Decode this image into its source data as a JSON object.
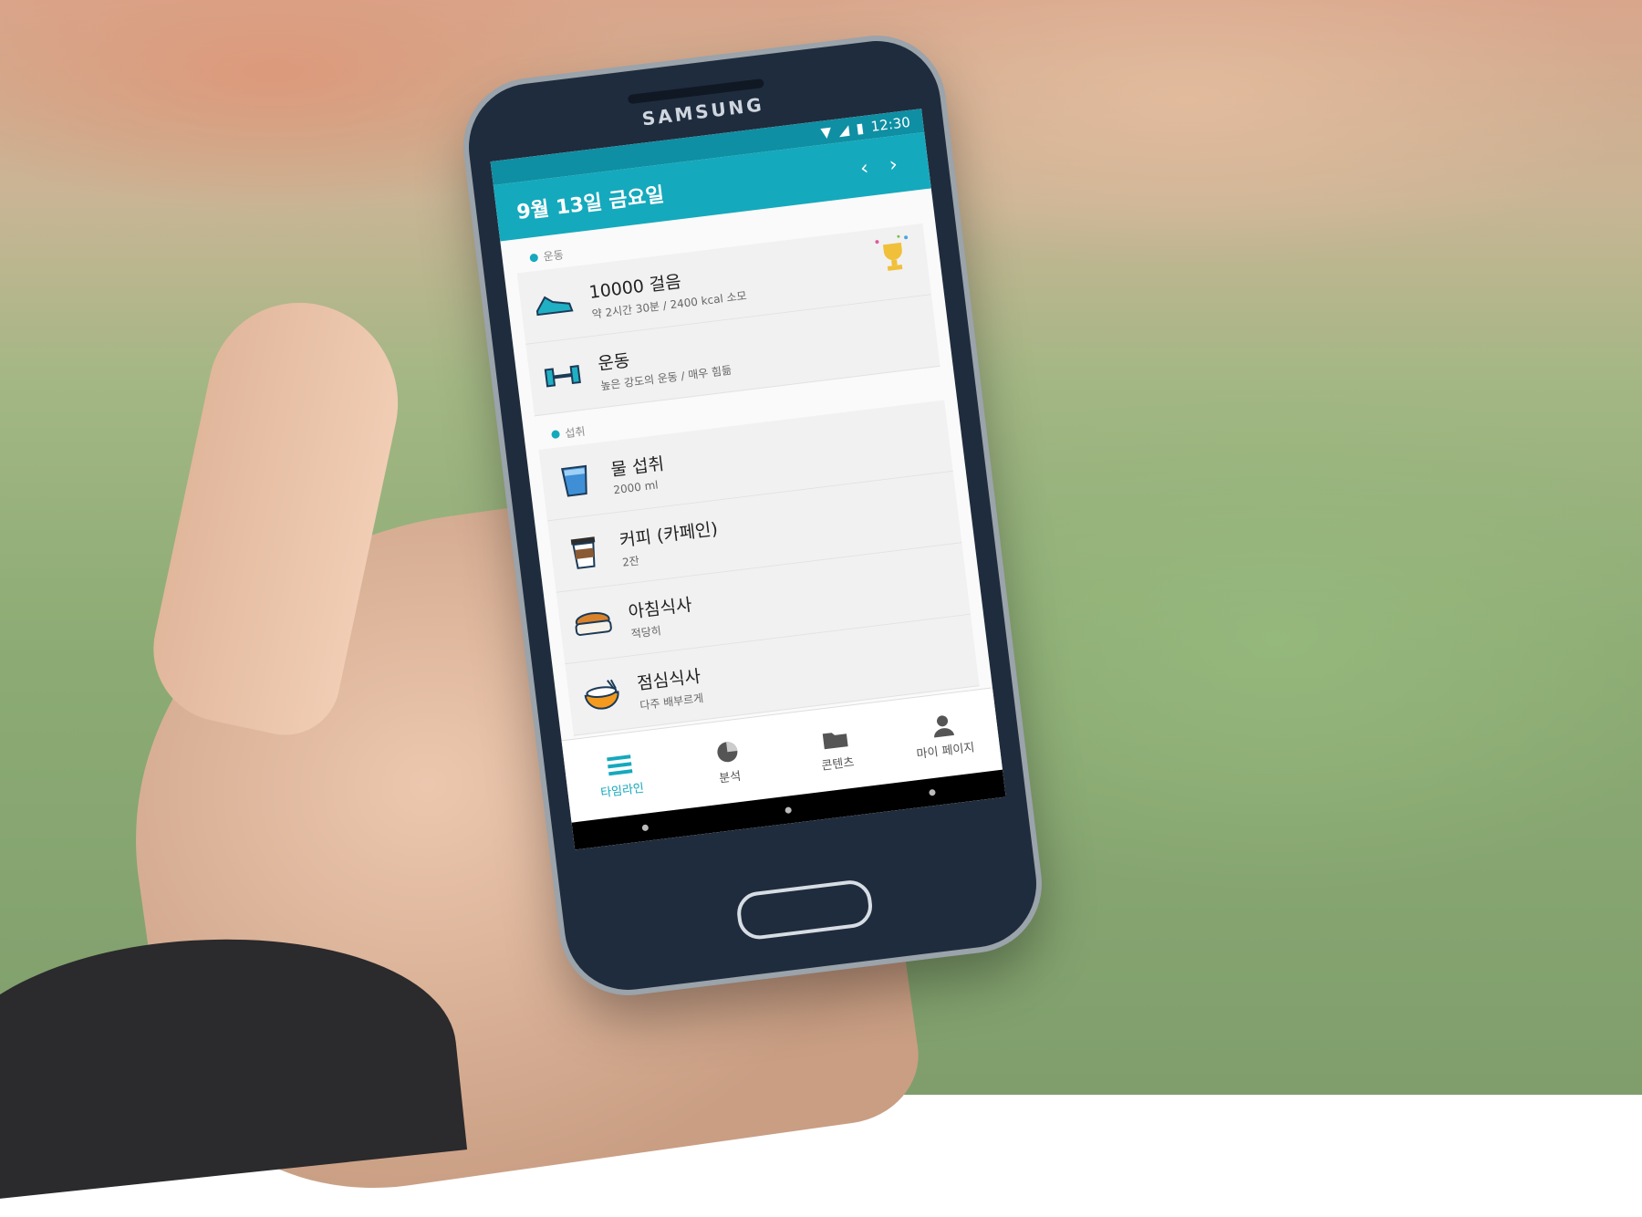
{
  "device": {
    "brand": "SAMSUNG"
  },
  "status_bar": {
    "time": "12:30"
  },
  "header": {
    "date": "9월 13일 금요일",
    "prev_icon": "‹",
    "next_icon": "›"
  },
  "sections": [
    {
      "label": "운동",
      "items": [
        {
          "icon": "shoe-icon",
          "title": "10000 걸음",
          "subtitle": "약 2시간 30분 / 2400 kcal 소모",
          "badge": "trophy-icon"
        },
        {
          "icon": "dumbbell-icon",
          "title": "운동",
          "subtitle": "높은 강도의 운동 / 매우 힘듦"
        }
      ]
    },
    {
      "label": "섭취",
      "items": [
        {
          "icon": "water-cup-icon",
          "title": "물 섭취",
          "subtitle": "2000 ml"
        },
        {
          "icon": "coffee-cup-icon",
          "title": "커피 (카페인)",
          "subtitle": "2잔"
        },
        {
          "icon": "bread-icon",
          "title": "아침식사",
          "subtitle": "적당히"
        },
        {
          "icon": "rice-bowl-icon",
          "title": "점심식사",
          "subtitle": "다주 배부르게"
        }
      ]
    }
  ],
  "bottom_nav": [
    {
      "label": "타임라인",
      "icon": "list-icon",
      "active": true
    },
    {
      "label": "분석",
      "icon": "pie-chart-icon",
      "active": false
    },
    {
      "label": "콘텐츠",
      "icon": "folder-icon",
      "active": false
    },
    {
      "label": "마이 페이지",
      "icon": "person-icon",
      "active": false
    }
  ],
  "colors": {
    "accent": "#15a9bd",
    "status": "#0e8fa3"
  }
}
